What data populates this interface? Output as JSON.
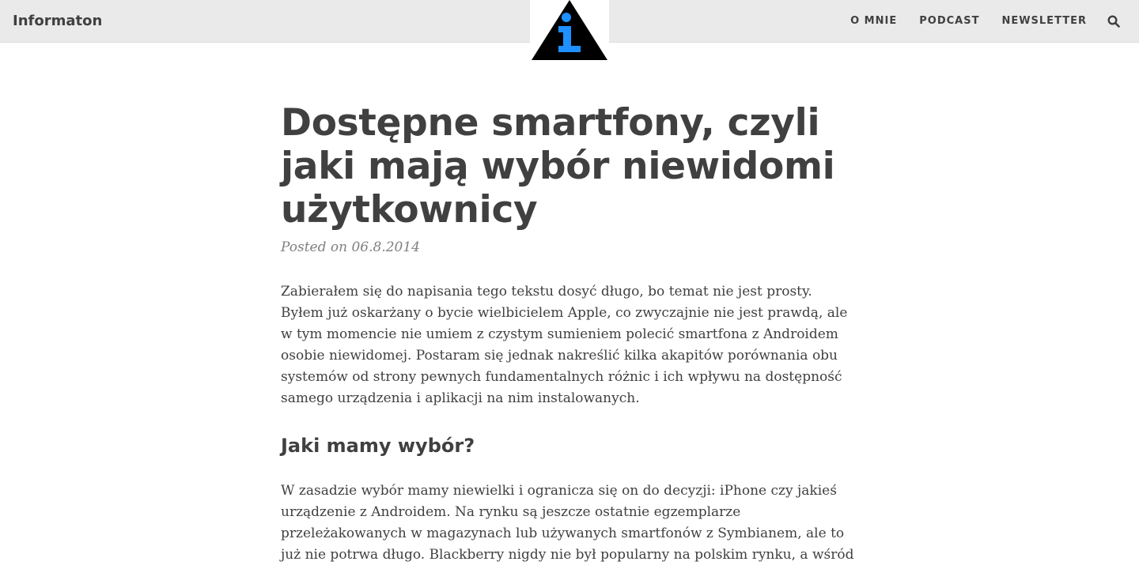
{
  "navbar": {
    "brand": "Informaton",
    "links": [
      "O MNIE",
      "PODCAST",
      "NEWSLETTER"
    ],
    "search_icon": "search-icon",
    "logo_icon": "information-triangle-logo",
    "colors": {
      "background": "#eaeaea",
      "logo_triangle": "#000000",
      "logo_i": "#1e90ff"
    }
  },
  "post": {
    "title": "Dostępne smartfony, czyli jaki mają wybór niewidomi użytkownicy",
    "meta": "Posted on 06.8.2014",
    "intro": "Zabierałem się do napisania tego tekstu dosyć długo, bo temat nie jest prosty. Byłem już oskarżany o bycie wielbicielem Apple, co zwyczajnie nie jest prawdą, ale w tym momencie nie umiem z czystym sumieniem polecić smartfona z Androidem osobie niewidomej. Postaram się jednak nakreślić kilka akapitów porównania obu systemów od strony pewnych fundamentalnych różnic i ich wpływu na dostępność samego urządzenia i aplikacji na nim instalowanych.",
    "section_heading": "Jaki mamy wybór?",
    "section_paragraph": "W zasadzie wybór mamy niewielki i ogranicza się on do decyzji: iPhone czy jakieś urządzenie z Androidem. Na rynku są jeszcze ostatnie egzemplarze przeleżakowanych w magazynach lub używanych smartfonów z Symbianem, ale to już nie potrwa długo. Blackberry nigdy nie był popularny na polskim rynku, a wśród osób niewidomych jest"
  }
}
